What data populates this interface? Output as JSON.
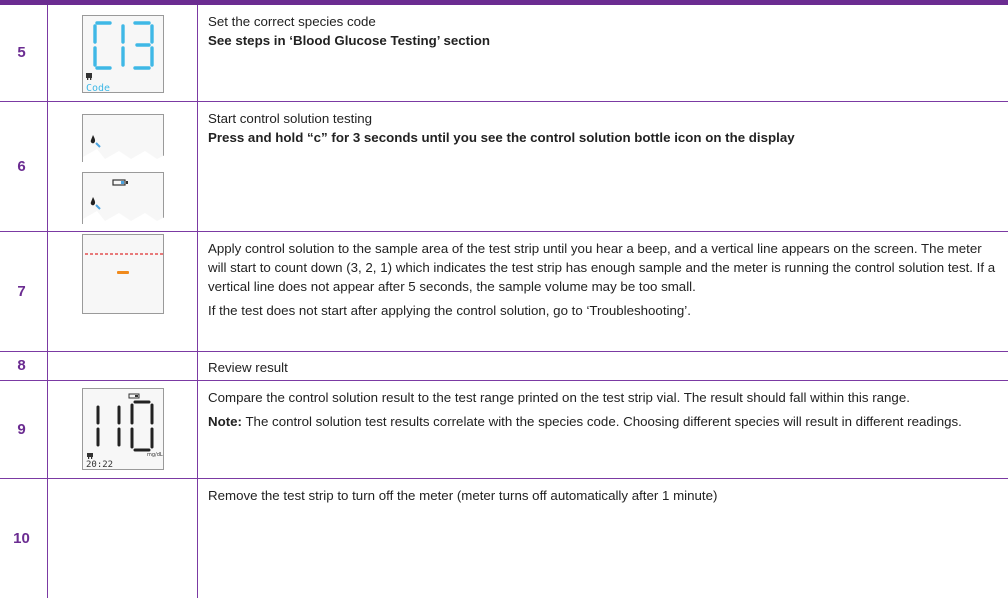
{
  "steps": [
    {
      "number": "5",
      "title": "Set the correct species code",
      "bold": "See steps in ‘Blood Glucose Testing’ section",
      "display": {
        "code_text": "Code",
        "icon": "animal-icon",
        "segment_color": "#3fb8e6"
      }
    },
    {
      "number": "6",
      "title": "Start control solution testing",
      "bold": "Press and hold “c” for 3 seconds until you see the control solution bottle icon on the display",
      "display": {
        "icons": [
          "blood-drop-icon",
          "control-solution-bottle-icon"
        ]
      }
    },
    {
      "number": "7",
      "paragraphs": [
        "Apply control solution to the sample area of the test strip until you hear a beep, and a vertical line appears on the screen. The meter will start to count down (3, 2, 1) which indicates the test strip has enough sample and the meter is running the control solution test. If a vertical line does not appear after 5 seconds, the sample volume may be too small.",
        "If the test does not start after applying the control solution, go to ‘Troubleshooting’."
      ],
      "display": {
        "accent_red": "#e03030",
        "accent_orange": "#f08a1c"
      }
    },
    {
      "number": "8",
      "title": "Review result"
    },
    {
      "number": "9",
      "paragraph": "Compare the control solution result to the test range printed on the test strip vial. The result should fall within this range.",
      "note_label": "Note:",
      "note_text": " The control solution test results correlate with the species code. Choosing different species will result in different readings.",
      "display": {
        "reading": "110",
        "unit": "mg/dL",
        "time": "20:22",
        "icon": "animal-icon"
      }
    },
    {
      "number": "10",
      "title": "Remove the test strip to turn off the meter (meter turns off automatically after 1 minute)"
    }
  ],
  "colors": {
    "accent": "#6b2c91",
    "border": "#7b3aa3"
  }
}
